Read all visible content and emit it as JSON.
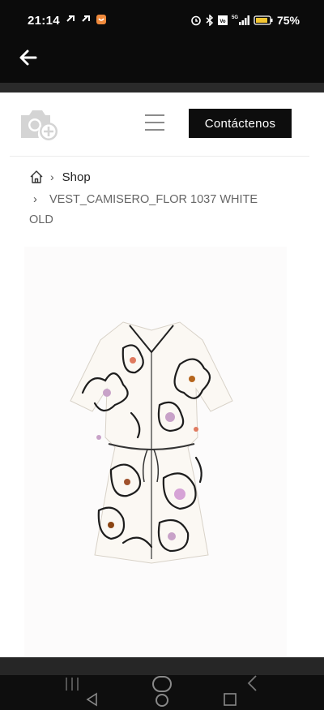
{
  "status_bar": {
    "time": "21:14",
    "battery": "75%",
    "icons": [
      "link-icon",
      "link-icon",
      "app-badge-icon",
      "alarm-icon",
      "bluetooth-icon",
      "volte-icon",
      "5g-icon",
      "signal-icon",
      "battery-icon"
    ]
  },
  "app_bar": {
    "back_icon": "arrow-left-icon"
  },
  "header": {
    "logo_icon": "camera-plus-icon",
    "menu_icon": "hamburger-icon",
    "contact_label": "Contáctenos"
  },
  "breadcrumb": {
    "home_icon": "home-icon",
    "shop_label": "Shop",
    "current_label": "VEST_CAMISERO_FLOR 1037 WHITE OLD"
  },
  "product": {
    "image_icon": "floral-shirt-dress-image"
  },
  "nav": {
    "icons": [
      "recents-icon",
      "back-triangle-icon",
      "home-pill-icon",
      "square-icon",
      "back-chevron-icon"
    ]
  }
}
